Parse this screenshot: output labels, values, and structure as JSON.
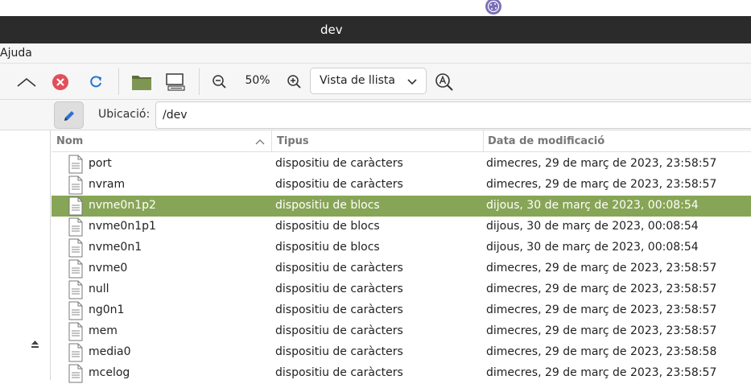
{
  "window": {
    "title": "dev"
  },
  "menubar": {
    "items": [
      "Ajuda"
    ]
  },
  "toolbar": {
    "zoom_level": "50%",
    "view_mode": "Vista de llista"
  },
  "location": {
    "label": "Ubicació:",
    "path": "/dev"
  },
  "columns": {
    "name": "Nom",
    "type": "Tipus",
    "modified": "Data de modificació"
  },
  "files": [
    {
      "name": "port",
      "type": "dispositiu de caràcters",
      "modified": "dimecres, 29 de març de 2023, 23:58:57",
      "selected": false
    },
    {
      "name": "nvram",
      "type": "dispositiu de caràcters",
      "modified": "dimecres, 29 de març de 2023, 23:58:57",
      "selected": false
    },
    {
      "name": "nvme0n1p2",
      "type": "dispositiu de blocs",
      "modified": "dijous, 30 de març de 2023, 00:08:54",
      "selected": true
    },
    {
      "name": "nvme0n1p1",
      "type": "dispositiu de blocs",
      "modified": "dijous, 30 de març de 2023, 00:08:54",
      "selected": false
    },
    {
      "name": "nvme0n1",
      "type": "dispositiu de blocs",
      "modified": "dijous, 30 de març de 2023, 00:08:54",
      "selected": false
    },
    {
      "name": "nvme0",
      "type": "dispositiu de caràcters",
      "modified": "dimecres, 29 de març de 2023, 23:58:57",
      "selected": false
    },
    {
      "name": "null",
      "type": "dispositiu de caràcters",
      "modified": "dimecres, 29 de març de 2023, 23:58:57",
      "selected": false
    },
    {
      "name": "ng0n1",
      "type": "dispositiu de caràcters",
      "modified": "dimecres, 29 de març de 2023, 23:58:57",
      "selected": false
    },
    {
      "name": "mem",
      "type": "dispositiu de caràcters",
      "modified": "dimecres, 29 de març de 2023, 23:58:57",
      "selected": false
    },
    {
      "name": "media0",
      "type": "dispositiu de caràcters",
      "modified": "dimecres, 29 de març de 2023, 23:58:58",
      "selected": false
    },
    {
      "name": "mcelog",
      "type": "dispositiu de caràcters",
      "modified": "dimecres, 29 de març de 2023, 23:58:57",
      "selected": false
    }
  ],
  "colors": {
    "selection": "#87a556",
    "stop": "#e0505b",
    "reload": "#1f74d6",
    "titlebar": "#2b2b2b"
  }
}
